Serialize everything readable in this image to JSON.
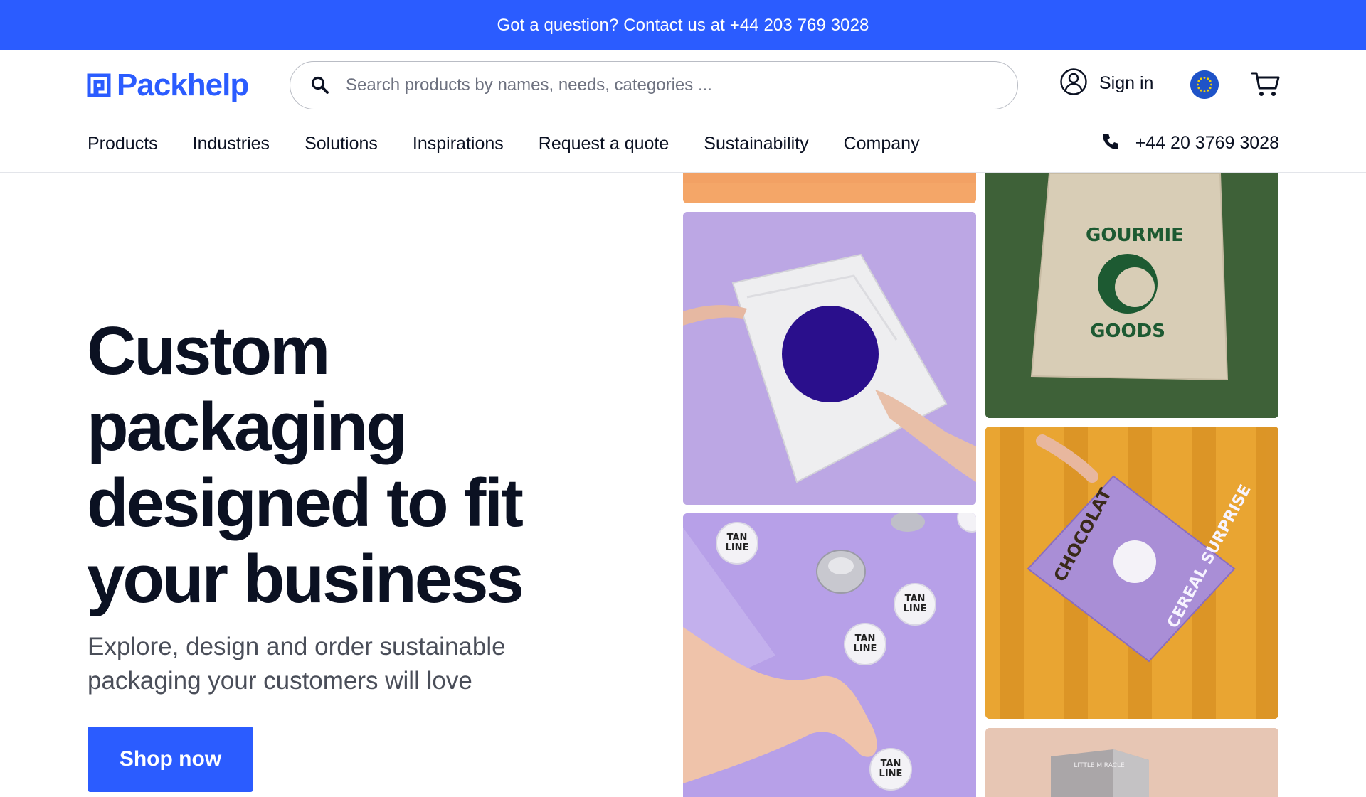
{
  "announcement": {
    "text": "Got a question? Contact us at +44 203 769 3028"
  },
  "brand": {
    "name": "Packhelp",
    "color": "#2b5cff"
  },
  "search": {
    "placeholder": "Search products by names, needs, categories ..."
  },
  "account": {
    "signin_label": "Sign in"
  },
  "nav": {
    "items": [
      {
        "label": "Products"
      },
      {
        "label": "Industries"
      },
      {
        "label": "Solutions"
      },
      {
        "label": "Inspirations"
      },
      {
        "label": "Request a quote"
      },
      {
        "label": "Sustainability"
      },
      {
        "label": "Company"
      }
    ],
    "phone": "+44 20 3769 3028"
  },
  "hero": {
    "title_lines": [
      "Custom",
      "packaging",
      "designed to fit",
      "your business"
    ],
    "subtitle": "Explore, design and order sustainable packaging your customers will love",
    "cta_label": "Shop now"
  },
  "gallery": {
    "tote": {
      "text_top": "GOURMIE",
      "text_bottom": "GOODS"
    },
    "badges": {
      "text": "TAN LINE"
    },
    "cereal": {
      "text_main": "CEREAL SURPRISE",
      "text_side": "CHOCOLAT"
    },
    "box": {
      "text": "LITTLE MIRACLE"
    }
  },
  "icons": {
    "search": "search-icon",
    "user": "user-icon",
    "region": "globe-flag-icon",
    "cart": "cart-icon",
    "phone": "phone-icon"
  },
  "colors": {
    "accent": "#2b5cff",
    "text": "#0b1122",
    "muted": "#4a4e59"
  }
}
